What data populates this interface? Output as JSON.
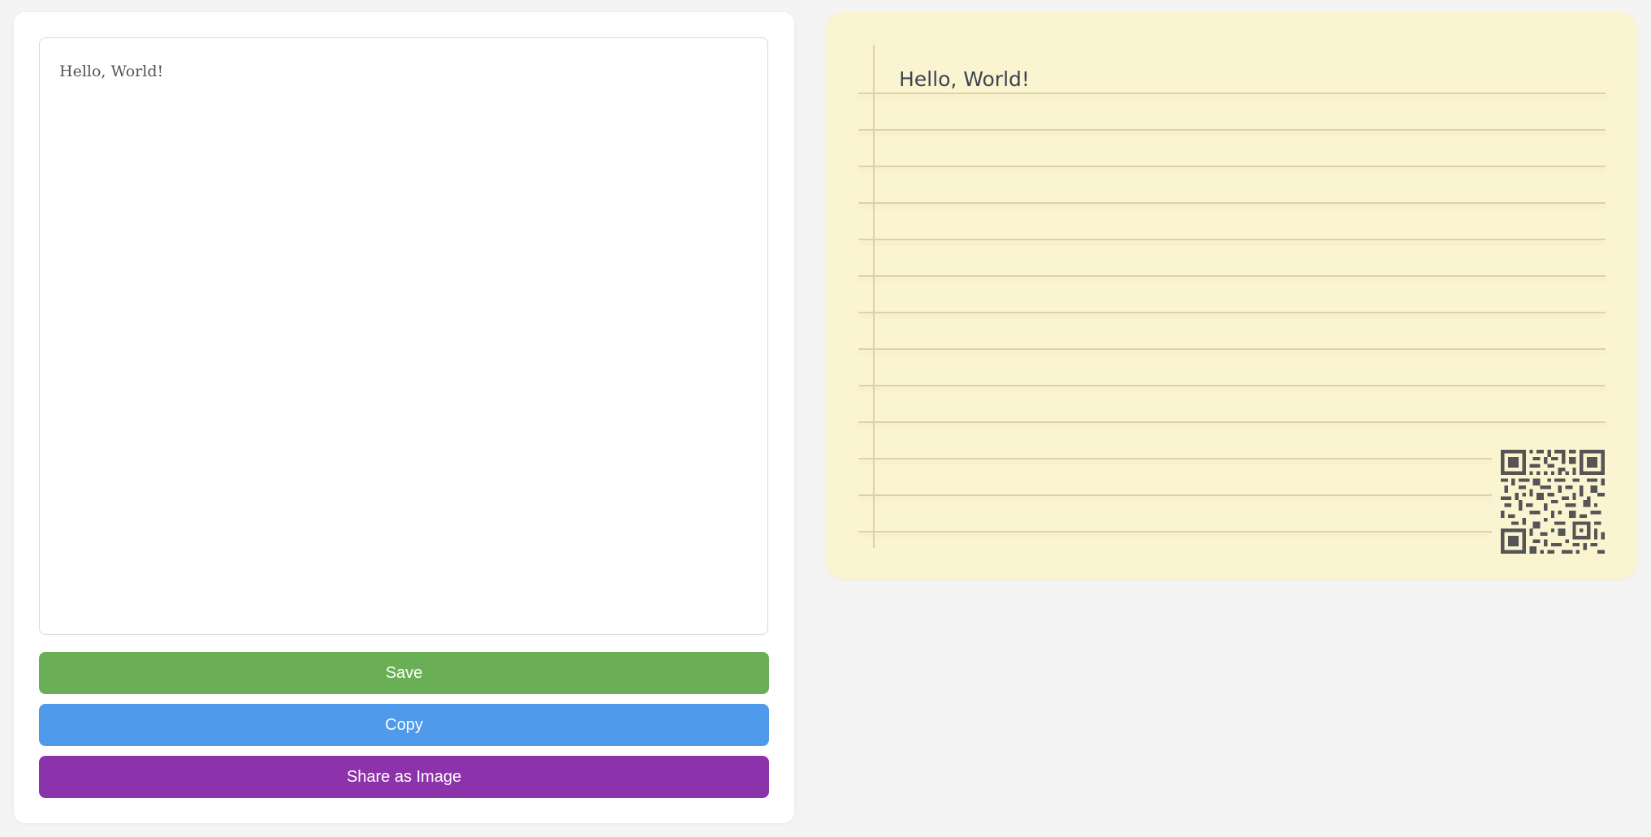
{
  "editor": {
    "content": "Hello, World!"
  },
  "actions": {
    "save_label": "Save",
    "copy_label": "Copy",
    "share_label": "Share as Image"
  },
  "preview": {
    "text": "Hello, World!",
    "qr_icon": "qr-code-icon"
  },
  "colors": {
    "save": "#6aaf56",
    "copy": "#4f9aeb",
    "share": "#8c33ac",
    "paper": "#fbf4d1"
  }
}
